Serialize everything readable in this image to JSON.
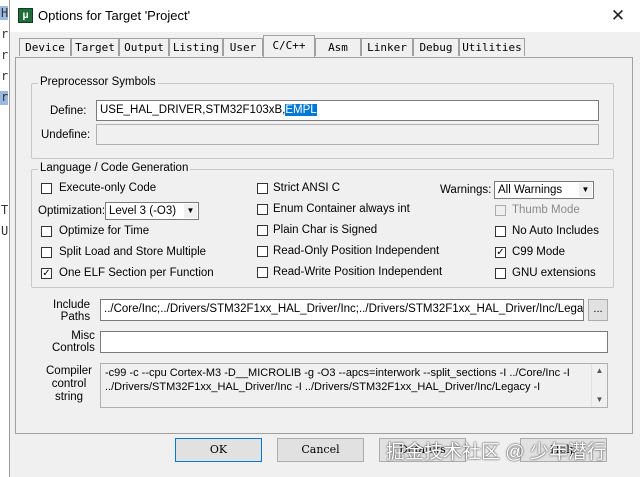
{
  "background": {
    "glyphs": [
      "H",
      "r",
      "r",
      "r",
      "r",
      "T",
      "U"
    ]
  },
  "window": {
    "title": "Options for Target 'Project'",
    "close_glyph": "✕"
  },
  "tabs": [
    "Device",
    "Target",
    "Output",
    "Listing",
    "User",
    "C/C++",
    "Asm",
    "Linker",
    "Debug",
    "Utilities"
  ],
  "active_tab": "C/C++",
  "preprocessor": {
    "title": "Preprocessor Symbols",
    "define_label": "Define:",
    "define_value": "USE_HAL_DRIVER,STM32F103xB,",
    "define_selected": "EMPL",
    "undefine_label": "Undefine:",
    "undefine_value": ""
  },
  "language": {
    "title": "Language / Code Generation",
    "execute_only": {
      "label": "Execute-only Code",
      "checked": false
    },
    "optimization_label": "Optimization:",
    "optimization_value": "Level 3 (-O3)",
    "optimize_time": {
      "label": "Optimize for Time",
      "checked": false
    },
    "split_load": {
      "label": "Split Load and Store Multiple",
      "checked": false
    },
    "one_elf": {
      "label": "One ELF Section per Function",
      "checked": true
    },
    "strict_ansi": {
      "label": "Strict ANSI C",
      "checked": false
    },
    "enum_container": {
      "label": "Enum Container always int",
      "checked": false
    },
    "plain_char": {
      "label": "Plain Char is Signed",
      "checked": false
    },
    "ro_pi": {
      "label": "Read-Only Position Independent",
      "checked": false
    },
    "rw_pi": {
      "label": "Read-Write Position Independent",
      "checked": false
    },
    "warnings_label": "Warnings:",
    "warnings_value": "All Warnings",
    "thumb_mode": {
      "label": "Thumb Mode",
      "checked": false,
      "disabled": true
    },
    "no_auto_includes": {
      "label": "No Auto Includes",
      "checked": false
    },
    "c99_mode": {
      "label": "C99 Mode",
      "checked": true
    },
    "gnu_extensions": {
      "label": "GNU extensions",
      "checked": false
    }
  },
  "include_paths": {
    "label_line1": "Include",
    "label_line2": "Paths",
    "value": "../Core/Inc;../Drivers/STM32F1xx_HAL_Driver/Inc;../Drivers/STM32F1xx_HAL_Driver/Inc/Legacy;",
    "browse_label": "..."
  },
  "misc_controls": {
    "label_line1": "Misc",
    "label_line2": "Controls",
    "value": ""
  },
  "compiler_control": {
    "label_line1": "Compiler",
    "label_line2": "control",
    "label_line3": "string",
    "line1": "-c99 -c --cpu Cortex-M3 -D__MICROLIB -g -O3 --apcs=interwork --split_sections -I ../Core/Inc -I",
    "line2": "../Drivers/STM32F1xx_HAL_Driver/Inc -I ../Drivers/STM32F1xx_HAL_Driver/Inc/Legacy -I"
  },
  "buttons": {
    "ok": "OK",
    "cancel": "Cancel",
    "defaults": "Defaults",
    "help": "Help"
  },
  "watermark": "掘金技术社区 @ 少年潜行",
  "colors": {
    "selection": "#0078d7",
    "dialog_bg": "#f0f0f0"
  }
}
